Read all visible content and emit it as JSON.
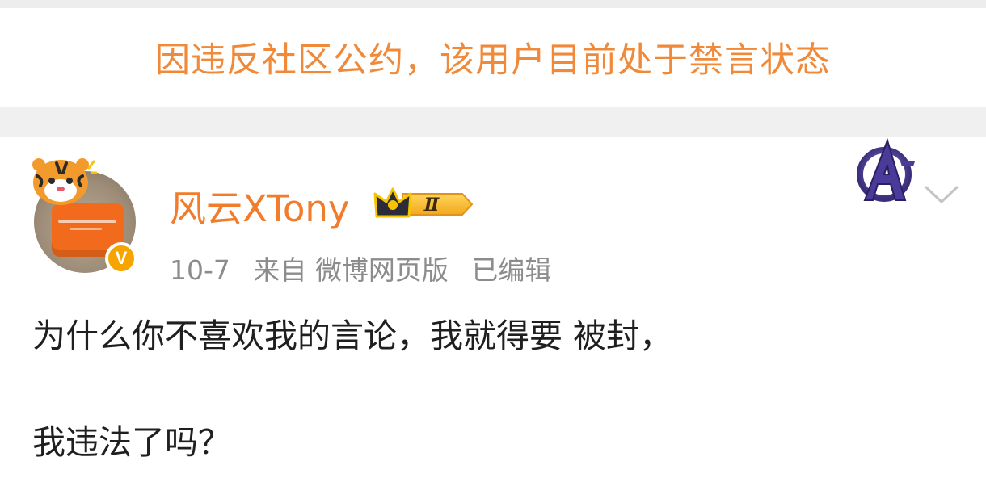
{
  "notice": {
    "text": "因违反社区公约，该用户目前处于禁言状态"
  },
  "post": {
    "username": "风云XTony",
    "level_badge": "Ⅱ",
    "verified_badge": "V",
    "date": "10-7",
    "source": "来自 微博网页版",
    "edited": "已编辑",
    "content_lines": [
      "为什么你不喜欢我的言论，我就得要 被封，",
      "我违法了吗？"
    ],
    "icons": {
      "avatar": "tiger-avatar",
      "member_badge": "crown-badge-icon",
      "decoration": "avengers-logo-icon",
      "menu": "chevron-down-icon"
    }
  },
  "colors": {
    "notice_text": "#f08a3a",
    "username": "#f07c2c",
    "meta_text": "#8c8c8c",
    "body_text": "#1f1f1f",
    "badge_gold": "#f6a500"
  }
}
